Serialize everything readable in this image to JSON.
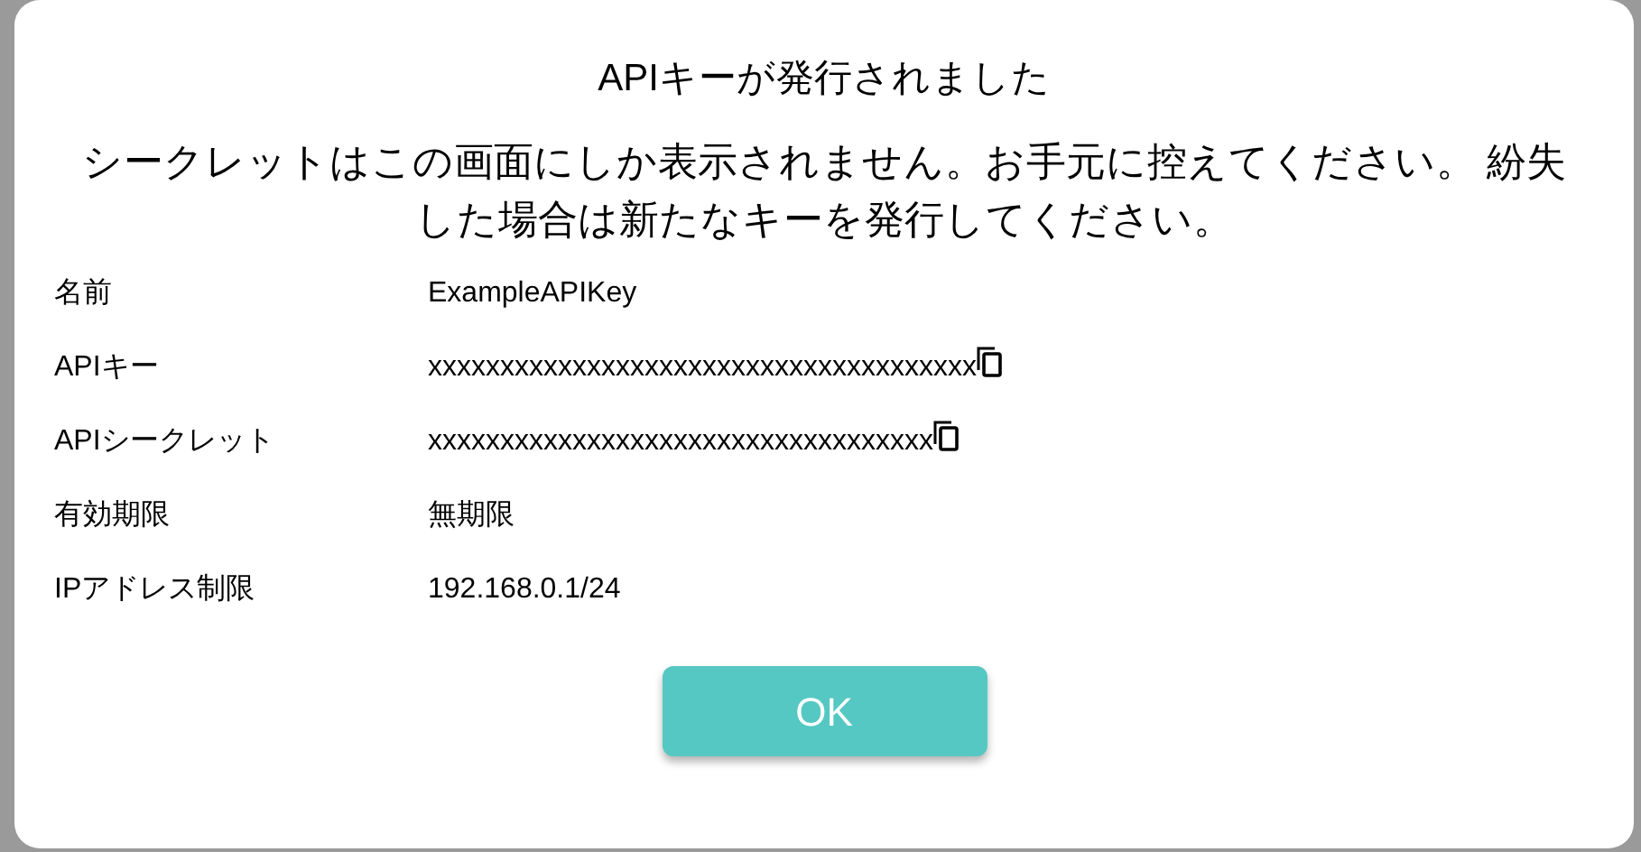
{
  "dialog": {
    "title": "APIキーが発行されました",
    "message": "シークレットはこの画面にしか表示されません。お手元に控えてください。 紛失した場合は新たなキーを発行してください。",
    "fields": [
      {
        "label": "名前",
        "value": "ExampleAPIKey",
        "copyable": false
      },
      {
        "label": "APIキー",
        "value": "xxxxxxxxxxxxxxxxxxxxxxxxxxxxxxxxxxxxxx",
        "copyable": true
      },
      {
        "label": "APIシークレット",
        "value": "xxxxxxxxxxxxxxxxxxxxxxxxxxxxxxxxxxx",
        "copyable": true
      },
      {
        "label": "有効期限",
        "value": "無期限",
        "copyable": false
      },
      {
        "label": "IPアドレス制限",
        "value": "192.168.0.1/24",
        "copyable": false
      }
    ],
    "button": "OK"
  }
}
